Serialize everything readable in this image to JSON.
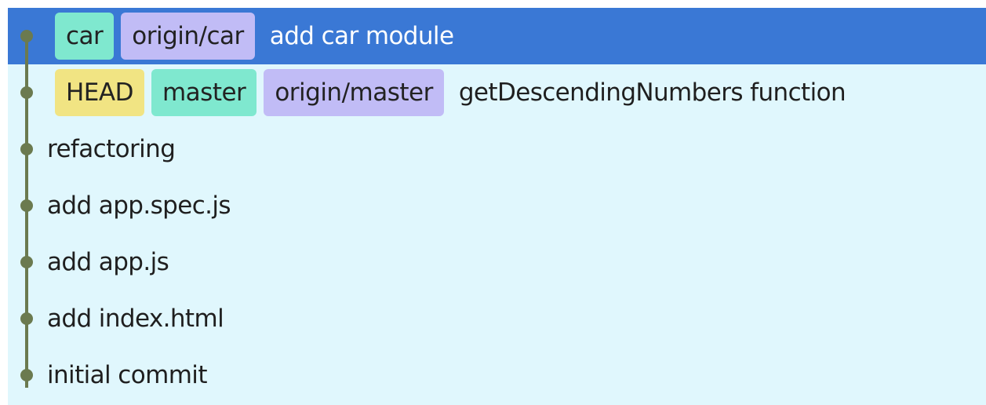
{
  "commits": [
    {
      "tags": [
        {
          "label": "car",
          "kind": "local"
        },
        {
          "label": "origin/car",
          "kind": "remote"
        }
      ],
      "message": "add car module",
      "selected": true
    },
    {
      "tags": [
        {
          "label": "HEAD",
          "kind": "head"
        },
        {
          "label": "master",
          "kind": "local"
        },
        {
          "label": "origin/master",
          "kind": "remote"
        }
      ],
      "message": "getDescendingNumbers function",
      "selected": false
    },
    {
      "tags": [],
      "message": "refactoring",
      "selected": false
    },
    {
      "tags": [],
      "message": "add app.spec.js",
      "selected": false
    },
    {
      "tags": [],
      "message": "add app.js",
      "selected": false
    },
    {
      "tags": [],
      "message": "add index.html",
      "selected": false
    },
    {
      "tags": [],
      "message": "initial commit",
      "selected": false
    }
  ],
  "colors": {
    "selected_row": "#3a78d5",
    "background": "#e0f7fd",
    "graph": "#6b7a4f",
    "head_tag": "#f1e483",
    "local_branch_tag": "#7fe8cf",
    "remote_branch_tag": "#c1bcf6"
  }
}
